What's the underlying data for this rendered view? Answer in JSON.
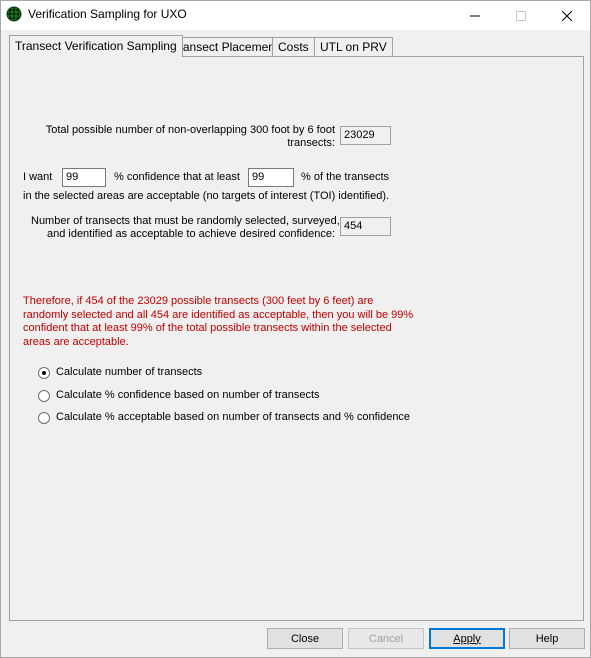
{
  "window": {
    "title": "Verification Sampling for UXO",
    "icon": "globe-grid-icon",
    "controls": {
      "minimize": "—",
      "maximize": "☐",
      "close": "✕"
    }
  },
  "tabs": [
    {
      "label": "Transect Verification Sampling",
      "active": true
    },
    {
      "label": "Transect Placement",
      "active": false
    },
    {
      "label": "Costs",
      "active": false
    },
    {
      "label": "UTL on PRV",
      "active": false
    }
  ],
  "main": {
    "total_label_line1": "Total possible number of non-overlapping 300 foot by 6 foot",
    "total_label_line2": "transects:",
    "total_value": "23029",
    "i_want_label": "I want",
    "confidence_value": "99",
    "confidence_label": "% confidence that at least",
    "acceptable_value": "99",
    "acceptable_label": "% of the transects",
    "selected_areas_label": "in the selected areas are acceptable (no targets of interest (TOI) identified).",
    "required_label_line1": "Number of transects that must be randomly selected, surveyed,",
    "required_label_line2": "and identified as acceptable to achieve desired confidence:",
    "required_value": "454",
    "conclusion": "Therefore, if 454 of the 23029 possible transects (300 feet by 6 feet) are randomly selected and all 454 are identified as acceptable, then you will be 99% confident that at least 99% of the total possible transects within the selected areas are acceptable.",
    "conclusion_color": "#c00000",
    "options": [
      {
        "label": "Calculate number of transects",
        "checked": true
      },
      {
        "label": "Calculate % confidence based on number of transects",
        "checked": false
      },
      {
        "label": "Calculate % acceptable based on number of transects and % confidence",
        "checked": false
      }
    ]
  },
  "footer": {
    "close_label": "Close",
    "cancel_label": "Cancel",
    "apply_label": "Apply",
    "help_label": "Help"
  }
}
